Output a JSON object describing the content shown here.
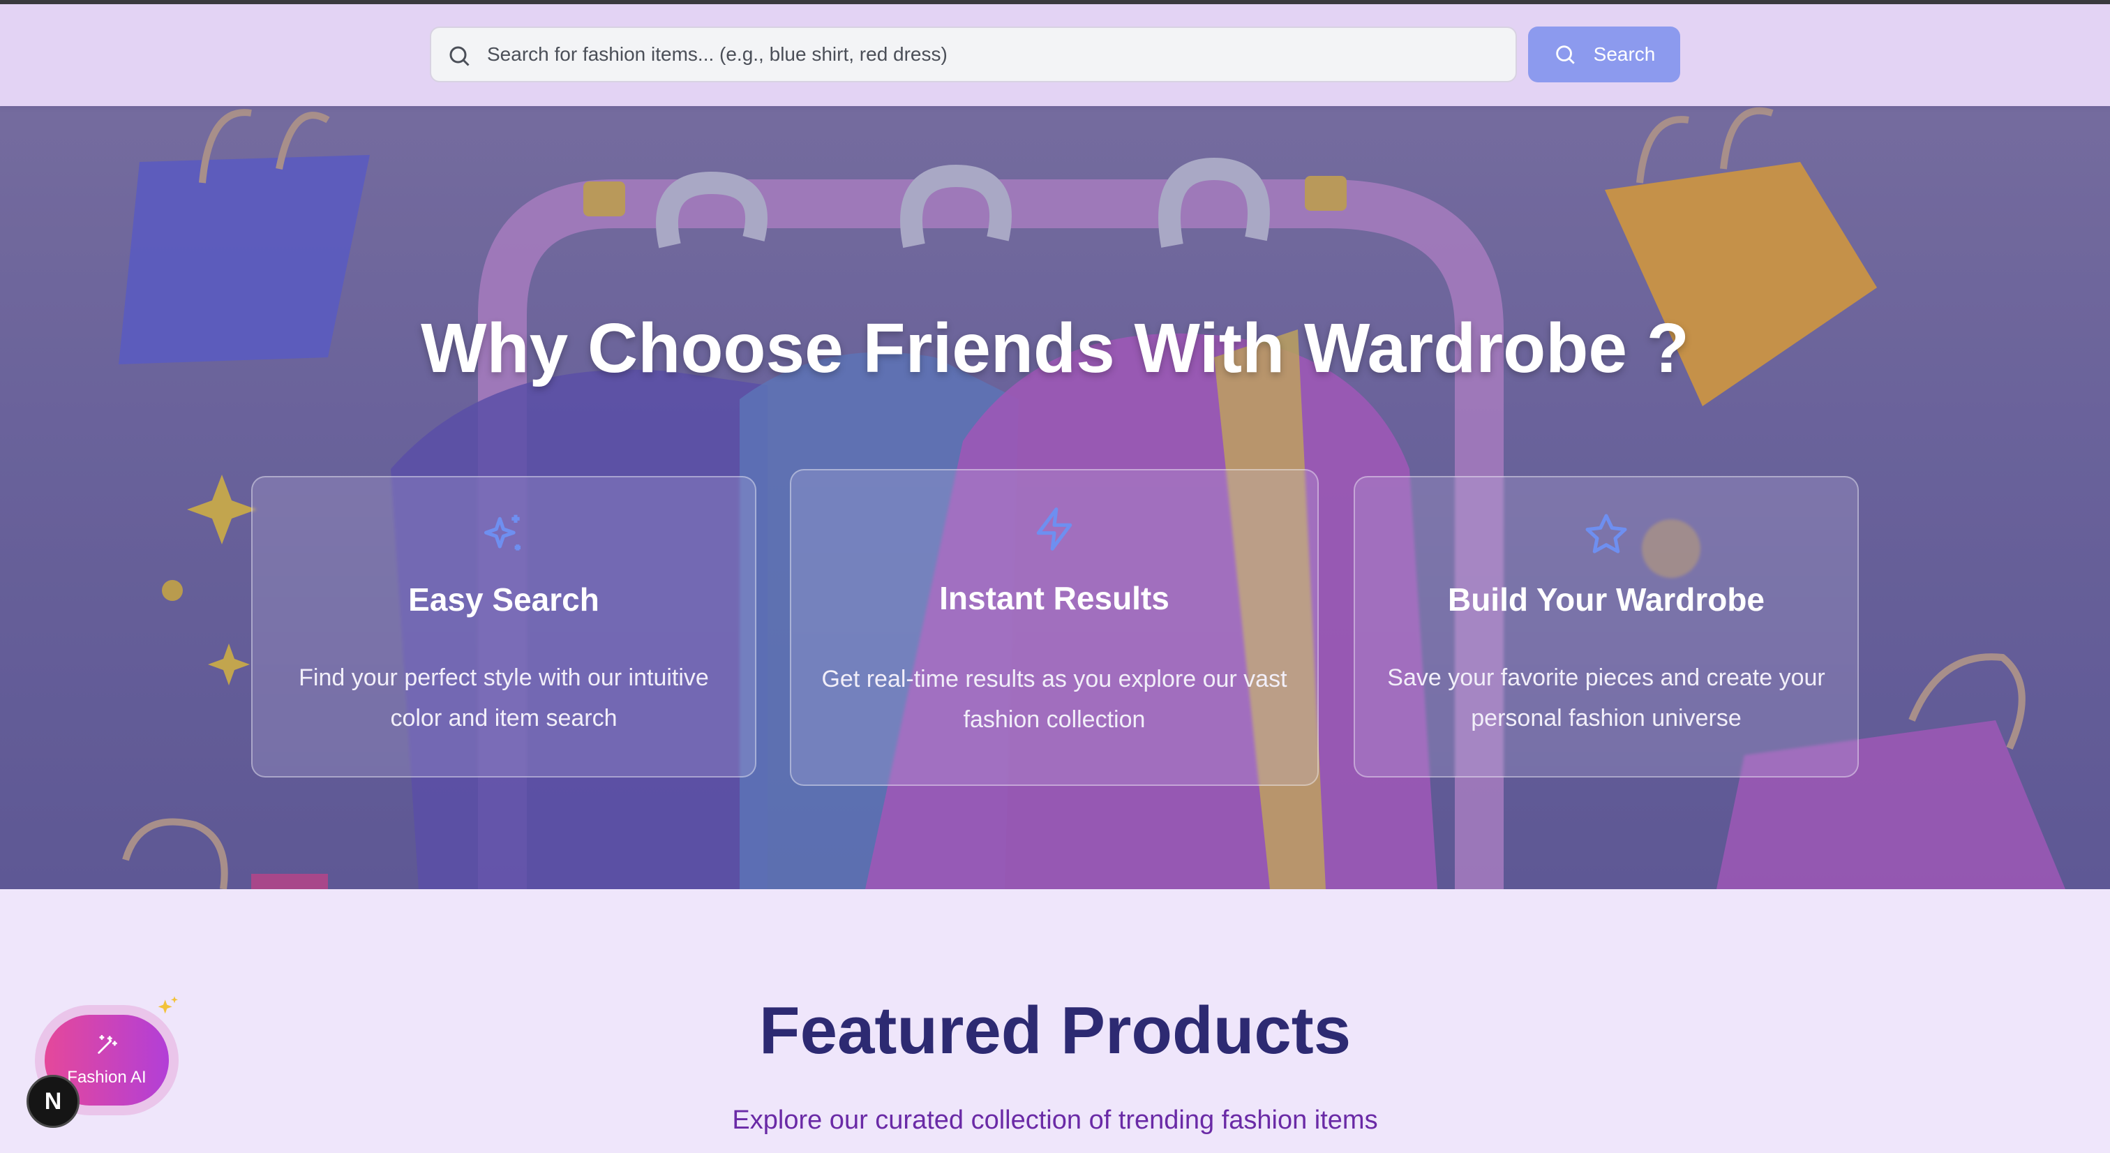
{
  "header": {
    "search_placeholder": "Search for fashion items... (e.g., blue shirt, red dress)",
    "search_button_label": "Search",
    "search_button_color": "#8c9aee"
  },
  "hero": {
    "title": "Why Choose Friends With Wardrobe ?",
    "features": [
      {
        "icon": "sparkles-icon",
        "title": "Easy Search",
        "description": "Find your perfect style with our intuitive color and item search"
      },
      {
        "icon": "lightning-icon",
        "title": "Instant Results",
        "description": "Get real-time results as you explore our vast fashion collection"
      },
      {
        "icon": "star-icon",
        "title": "Build Your Wardrobe",
        "description": "Save your favorite pieces and create your personal fashion universe"
      }
    ],
    "accent_icon_color": "#6e8ff0"
  },
  "featured": {
    "title": "Featured Products",
    "subtitle": "Explore our curated collection of trending fashion items",
    "title_color": "#2d2a72",
    "subtitle_color": "#6a2aa6"
  },
  "floating": {
    "fashion_ai_label": "Fashion AI",
    "badge_letter": "N"
  }
}
